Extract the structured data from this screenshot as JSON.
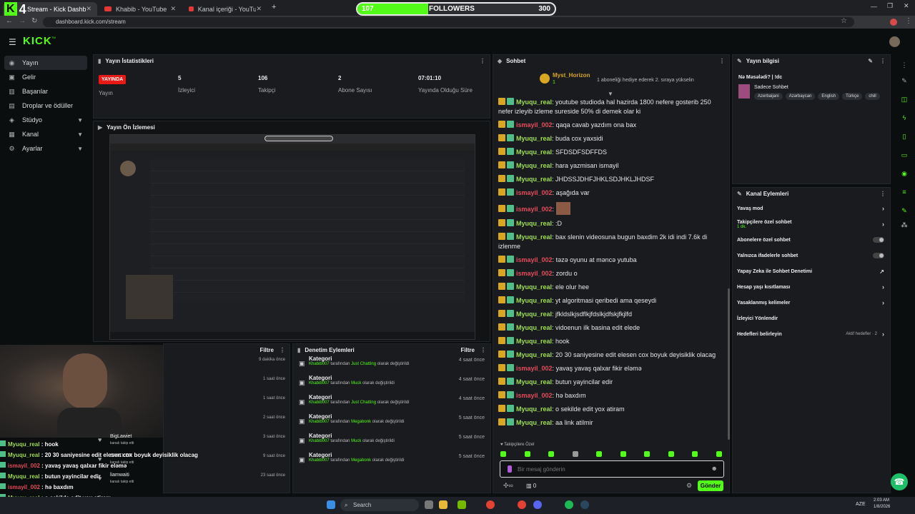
{
  "browser": {
    "tabs": [
      {
        "label": "Stream - Kick Dashboard",
        "active": true
      },
      {
        "label": "Khabib - YouTube",
        "active": false
      },
      {
        "label": "Kanal içeriği - YouTube Studio",
        "active": false
      }
    ],
    "url": "dashboard.kick.com/stream"
  },
  "goal": {
    "start": "107",
    "label": "FOLLOWERS",
    "target": "300",
    "logo_text": "K",
    "logo_num": "4",
    "progress": 0.357
  },
  "kick": {
    "logo": "KICK",
    "tm": "TM"
  },
  "sidebar": {
    "items": [
      {
        "label": "Yayın",
        "icon": "broadcast-icon"
      },
      {
        "label": "Gelir",
        "icon": "revenue-icon"
      },
      {
        "label": "Başarılar",
        "icon": "achievements-icon"
      },
      {
        "label": "Droplar ve ödüller",
        "icon": "drops-icon"
      },
      {
        "label": "Stüdyo",
        "icon": "studio-icon"
      },
      {
        "label": "Kanal",
        "icon": "channel-icon"
      },
      {
        "label": "Ayarlar",
        "icon": "settings-icon"
      }
    ]
  },
  "stats": {
    "title": "Yayın İstatistikleri",
    "live_badge": "YAYINDA",
    "live_label": "Yayın",
    "viewers_value": "5",
    "viewers_label": "İzleyici",
    "followers_value": "106",
    "followers_label": "Takipçi",
    "subs_value": "2",
    "subs_label": "Abone Sayısı",
    "uptime_value": "07:01:10",
    "uptime_label": "Yayında Olduğu Süre"
  },
  "preview": {
    "title": "Yayın Ön İzlemesi"
  },
  "activity": {
    "filter": "Filtre",
    "rows": [
      {
        "name": "",
        "sub": "",
        "time": "9 dakika önce"
      },
      {
        "name": "",
        "sub": "",
        "time": "1 saat önce"
      },
      {
        "name": "",
        "sub": "",
        "time": "1 saat önce"
      },
      {
        "name": "",
        "sub": "",
        "time": "2 saat önce"
      },
      {
        "name": "BigLawiet",
        "sub": "kanalı takip etti",
        "time": "3 saat önce"
      },
      {
        "name": "SNICKER",
        "sub": "kanalı takip etti",
        "time": "9 saat önce"
      },
      {
        "name": "liamwaiti",
        "sub": "kanalı takip etti",
        "time": "23 saat önce"
      }
    ]
  },
  "moderation": {
    "title": "Denetim Eylemleri",
    "filter": "Filtre",
    "rows": [
      {
        "title": "Kategori",
        "user": "Khabib007",
        "mid": "tarafından",
        "cat": "Just Chatting",
        "end": "olarak değiştirildi",
        "time": "4 saat önce"
      },
      {
        "title": "Kategori",
        "user": "Khabib007",
        "mid": "tarafından",
        "cat": "Muck",
        "end": "olarak değiştirildi",
        "time": "4 saat önce"
      },
      {
        "title": "Kategori",
        "user": "Khabib007",
        "mid": "tarafından",
        "cat": "Just Chatting",
        "end": "olarak değiştirildi",
        "time": "4 saat önce"
      },
      {
        "title": "Kategori",
        "user": "Khabib007",
        "mid": "tarafından",
        "cat": "Megabonk",
        "end": "olarak değiştirildi",
        "time": "5 saat önce"
      },
      {
        "title": "Kategori",
        "user": "Khabib007",
        "mid": "tarafından",
        "cat": "Muck",
        "end": "olarak değiştirildi",
        "time": "5 saat önce"
      },
      {
        "title": "Kategori",
        "user": "Khabib007",
        "mid": "tarafından",
        "cat": "Megabonk",
        "end": "olarak değiştirildi",
        "time": "5 saat önce"
      }
    ]
  },
  "chat": {
    "title": "Sohbet",
    "pinned_user": "Myst_Horizon",
    "pinned_count": "1",
    "pinned_text": "1 aboneliği hediye ederek 2. sıraya yükselin",
    "messages": [
      {
        "user": "Myuqu_real",
        "type": 1,
        "text": "youtube studioda hal hazirda 1800 nefere gosterib 250 nefer izleyib izleme sureside 50% di demek olar ki"
      },
      {
        "user": "ismayil_002",
        "type": 2,
        "text": "qaqa cavab yazdım ona bax"
      },
      {
        "user": "Myuqu_real",
        "type": 1,
        "text": "buda cox yaxsidi"
      },
      {
        "user": "Myuqu_real",
        "type": 1,
        "text": "SFDSDFSDFFDS"
      },
      {
        "user": "Myuqu_real",
        "type": 1,
        "text": "hara yazmisan ismayil"
      },
      {
        "user": "Myuqu_real",
        "type": 1,
        "text": "JHDSSJDHFJHKLSDJHKLJHDSF"
      },
      {
        "user": "ismayil_002",
        "type": 2,
        "text": "aşağıda var"
      },
      {
        "user": "ismayil_002",
        "type": 2,
        "text": ""
      },
      {
        "user": "Myuqu_real",
        "type": 1,
        "text": ":D"
      },
      {
        "user": "Myuqu_real",
        "type": 1,
        "text": "bax slenin videosuna bugun baxdim 2k idi indi 7.6k di izlenme"
      },
      {
        "user": "ismayil_002",
        "type": 2,
        "text": "təzə oyunu at məncə yutuba"
      },
      {
        "user": "ismayil_002",
        "type": 2,
        "text": "zordu o"
      },
      {
        "user": "Myuqu_real",
        "type": 1,
        "text": "ele olur hee"
      },
      {
        "user": "Myuqu_real",
        "type": 1,
        "text": "yt algoritmasi qeribedi ama qeseydi"
      },
      {
        "user": "Myuqu_real",
        "type": 1,
        "text": "jfkldslkjsdflkjfdslkjdfskjfkjlfd"
      },
      {
        "user": "Myuqu_real",
        "type": 1,
        "text": "vidoenun ilk basina edit elede"
      },
      {
        "user": "Myuqu_real",
        "type": 1,
        "text": "hook"
      },
      {
        "user": "Myuqu_real",
        "type": 1,
        "text": "20 30 saniyesine edit elesen cox boyuk deyisiklik olacag"
      },
      {
        "user": "ismayil_002",
        "type": 2,
        "text": "yavaş yavaş qalxar fikir eləmə"
      },
      {
        "user": "Myuqu_real",
        "type": 1,
        "text": "butun yayincilar edir"
      },
      {
        "user": "ismayil_002",
        "type": 2,
        "text": "hə baxdım"
      },
      {
        "user": "Myuqu_real",
        "type": 1,
        "text": "o sekilde edit yox atiram"
      },
      {
        "user": "Myuqu_real",
        "type": 1,
        "text": "aa link atilmir"
      }
    ],
    "followers_only": "Takipçilere Özel",
    "input_placeholder": "Bir mesaj gönderin",
    "send": "Gönder",
    "count": "0"
  },
  "stream_info": {
    "title": "Yayın bilgisi",
    "stream_title": "Nə Məsələdi? | !dc",
    "category": "Sadece Sohbet",
    "tags": [
      "Azerbaijani",
      "Azərbaycan",
      "English",
      "Türkçe",
      "chill"
    ]
  },
  "channel_actions": {
    "title": "Kanal Eylemleri",
    "rows": [
      {
        "label": "Yavaş mod",
        "control": "chevron"
      },
      {
        "label": "Takipçilere özel sohbet",
        "sub": "1 dk.",
        "control": "chevron"
      },
      {
        "label": "Abonelere özel sohbet",
        "control": "toggle"
      },
      {
        "label": "Yalnızca ifadelerle sohbet",
        "control": "toggle"
      },
      {
        "label": "Yapay Zeka ile Sohbet Denetimi",
        "control": "external"
      },
      {
        "label": "Hesap yaşı kısıtlaması",
        "control": "chevron"
      },
      {
        "label": "Yasaklanmış kelimeler",
        "control": "chevron"
      },
      {
        "label": "İzleyici Yönlendir",
        "control": "none"
      },
      {
        "label": "Hedefleri belirleyin",
        "extra": "Aktif hedefler · 2",
        "control": "chevron"
      }
    ]
  },
  "overlay_chat": [
    {
      "user": "Myuqu_real",
      "type": 1,
      "text": "hook"
    },
    {
      "user": "Myuqu_real",
      "type": 1,
      "text": "20 30 saniyesine edit elesen cox boyuk deyisiklik olacag"
    },
    {
      "user": "ismayil_002",
      "type": 2,
      "text": "yavaş yavaş qalxar fikir eləmə"
    },
    {
      "user": "Myuqu_real",
      "type": 1,
      "text": "butun yayincilar edir"
    },
    {
      "user": "ismayil_002",
      "type": 2,
      "text": "hə baxdım"
    },
    {
      "user": "Myuqu_real",
      "type": 1,
      "text": "o sekilde edit yox atiram"
    },
    {
      "user": "Myuqu_real",
      "type": 1,
      "text": "aa link atilmir"
    }
  ],
  "taskbar": {
    "search": "Search",
    "lang": "AZE",
    "time": "2:03 AM",
    "date": "1/8/2026"
  },
  "colors": {
    "kick_green": "#53fc18",
    "live_red": "#e91916",
    "bg": "#0b0e0f",
    "panel": "#191b1f"
  }
}
